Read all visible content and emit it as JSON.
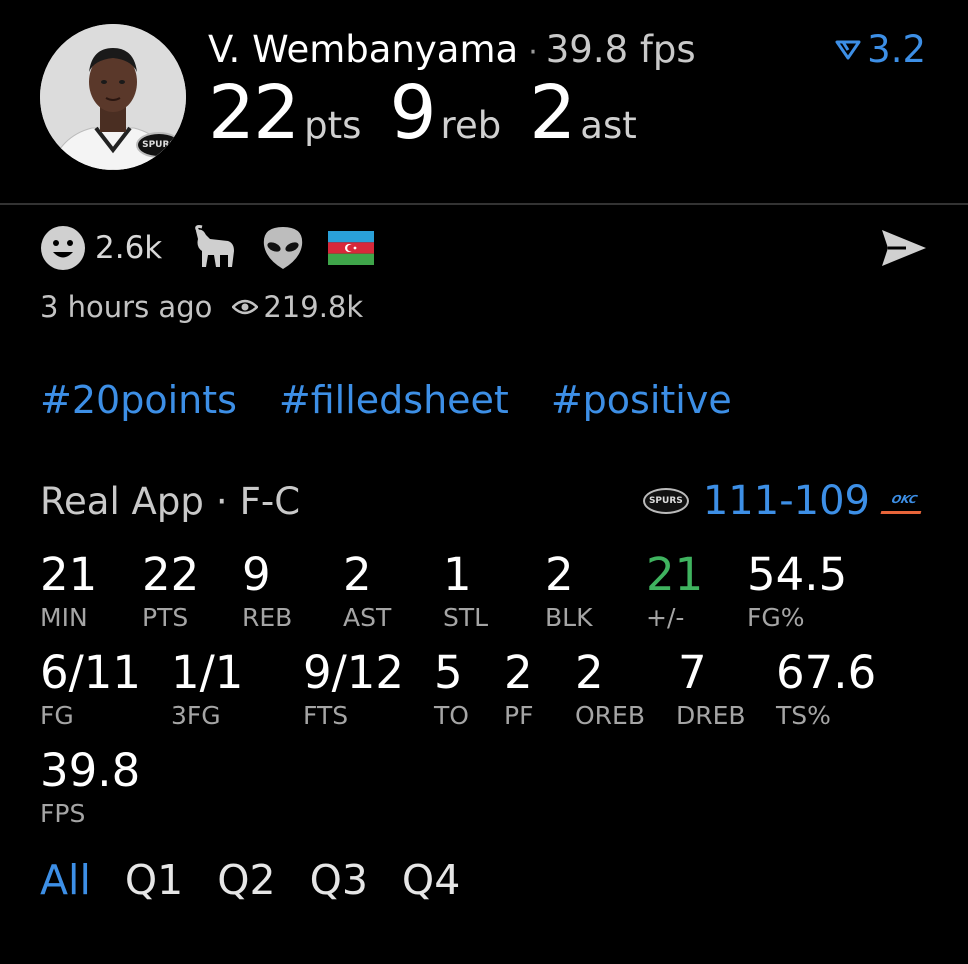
{
  "player": {
    "name": "V. Wembanyama",
    "fps_label": "39.8 fps",
    "boost": "3.2",
    "team_badge": "SPURS",
    "headline": [
      {
        "value": "22",
        "unit": "pts"
      },
      {
        "value": "9",
        "unit": "reb"
      },
      {
        "value": "2",
        "unit": "ast"
      }
    ]
  },
  "reactions": {
    "smile_count": "2.6k",
    "icons": [
      "smile-icon",
      "goat-icon",
      "alien-icon",
      "azerbaijan-flag-icon"
    ]
  },
  "meta": {
    "time_ago": "3 hours ago",
    "views": "219.8k"
  },
  "hashtags": [
    "#20points",
    "#filledsheet",
    "#positive"
  ],
  "game": {
    "source": "Real App",
    "position": "F-C",
    "score": "111-109",
    "home_badge": "SPURS",
    "away_badge": "OKC"
  },
  "stats": [
    {
      "value": "21",
      "label": "MIN"
    },
    {
      "value": "22",
      "label": "PTS"
    },
    {
      "value": "9",
      "label": "REB"
    },
    {
      "value": "2",
      "label": "AST"
    },
    {
      "value": "1",
      "label": "STL"
    },
    {
      "value": "2",
      "label": "BLK"
    },
    {
      "value": "21",
      "label": "+/-"
    },
    {
      "value": "54.5",
      "label": "FG%"
    },
    {
      "value": "6/11",
      "label": "FG"
    },
    {
      "value": "1/1",
      "label": "3FG"
    },
    {
      "value": "9/12",
      "label": "FTS"
    },
    {
      "value": "5",
      "label": "TO"
    },
    {
      "value": "2",
      "label": "PF"
    },
    {
      "value": "2",
      "label": "OREB"
    },
    {
      "value": "7",
      "label": "DREB"
    },
    {
      "value": "67.6",
      "label": "TS%"
    },
    {
      "value": "39.8",
      "label": "FPS"
    }
  ],
  "tabs": [
    "All",
    "Q1",
    "Q2",
    "Q3",
    "Q4"
  ],
  "colors": {
    "accent": "#3d8fe6",
    "positive": "#3fb35f",
    "background": "#000000"
  }
}
